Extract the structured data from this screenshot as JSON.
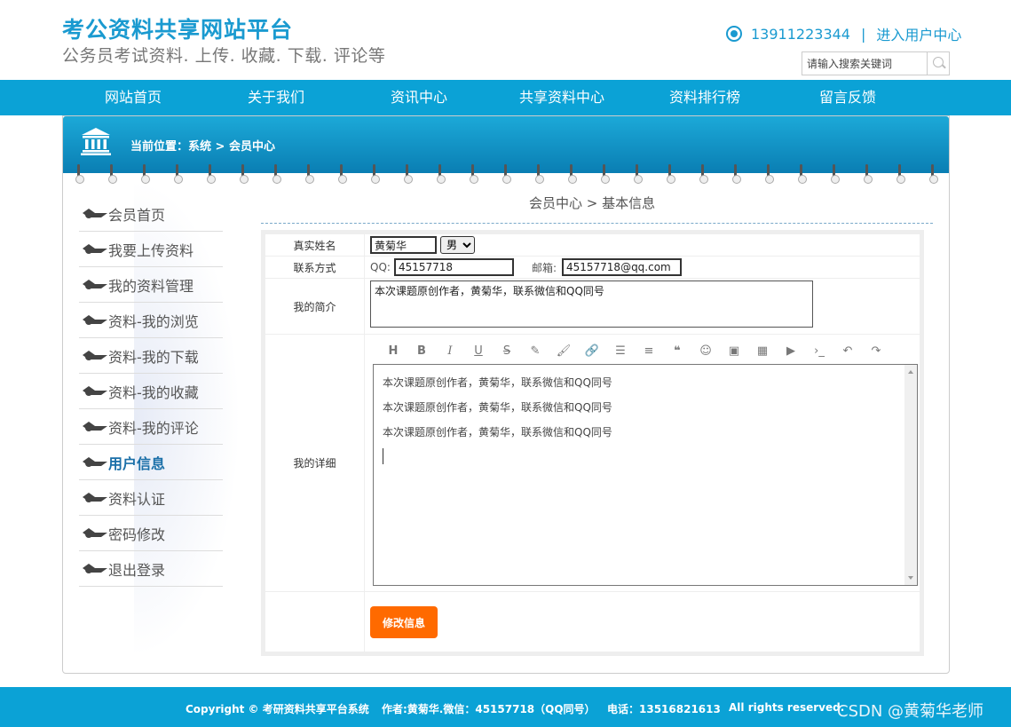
{
  "header": {
    "site_title": "考公资料共享网站平台",
    "site_subtitle": "公务员考试资料. 上传. 收藏. 下载. 评论等",
    "phone": "13911223344",
    "separator": "|",
    "user_center_link": "进入用户中心",
    "search_placeholder": "请输入搜索关键词"
  },
  "nav": {
    "items": [
      "网站首页",
      "关于我们",
      "资讯中心",
      "共享资料中心",
      "资料排行榜",
      "留言反馈"
    ]
  },
  "breadcrumb": {
    "text": "当前位置：系统 > 会员中心"
  },
  "sidebar": {
    "items": [
      {
        "label": "会员首页"
      },
      {
        "label": "我要上传资料"
      },
      {
        "label": "我的资料管理"
      },
      {
        "label": "资料-我的浏览"
      },
      {
        "label": "资料-我的下载"
      },
      {
        "label": "资料-我的收藏"
      },
      {
        "label": "资料-我的评论"
      },
      {
        "label": "用户信息"
      },
      {
        "label": "资料认证"
      },
      {
        "label": "密码修改"
      },
      {
        "label": "退出登录"
      }
    ],
    "active_index": 7
  },
  "content": {
    "title": "会员中心 > 基本信息",
    "form": {
      "name_label": "真实姓名",
      "name_value": "黄菊华",
      "gender_value": "男",
      "contact_label": "联系方式",
      "qq_label": "QQ:",
      "qq_value": "45157718",
      "email_label": "邮箱:",
      "email_value": "45157718@qq.com",
      "intro_label": "我的简介",
      "intro_value": "本次课题原创作者，黄菊华，联系微信和QQ同号",
      "detail_label": "我的详细",
      "detail_lines": [
        "本次课题原创作者，黄菊华，联系微信和QQ同号",
        "本次课题原创作者，黄菊华，联系微信和QQ同号",
        "本次课题原创作者，黄菊华，联系微信和QQ同号"
      ],
      "submit_label": "修改信息"
    },
    "toolbar": {
      "heading": "H",
      "bold": "B",
      "italic": "I",
      "underline": "U",
      "strike": "S"
    }
  },
  "footer": {
    "copyright": "Copyright © 考研资料共享平台系统",
    "author": "作者:黄菊华.微信：45157718（QQ同号）",
    "phone": "电话：13516821613",
    "rights": "All rights reserved."
  },
  "watermark": "CSDN @黄菊华老师",
  "colors": {
    "brand_blue": "#0ba2d6",
    "title_blue": "#1a9ad0",
    "submit_orange": "#ff6a00"
  }
}
